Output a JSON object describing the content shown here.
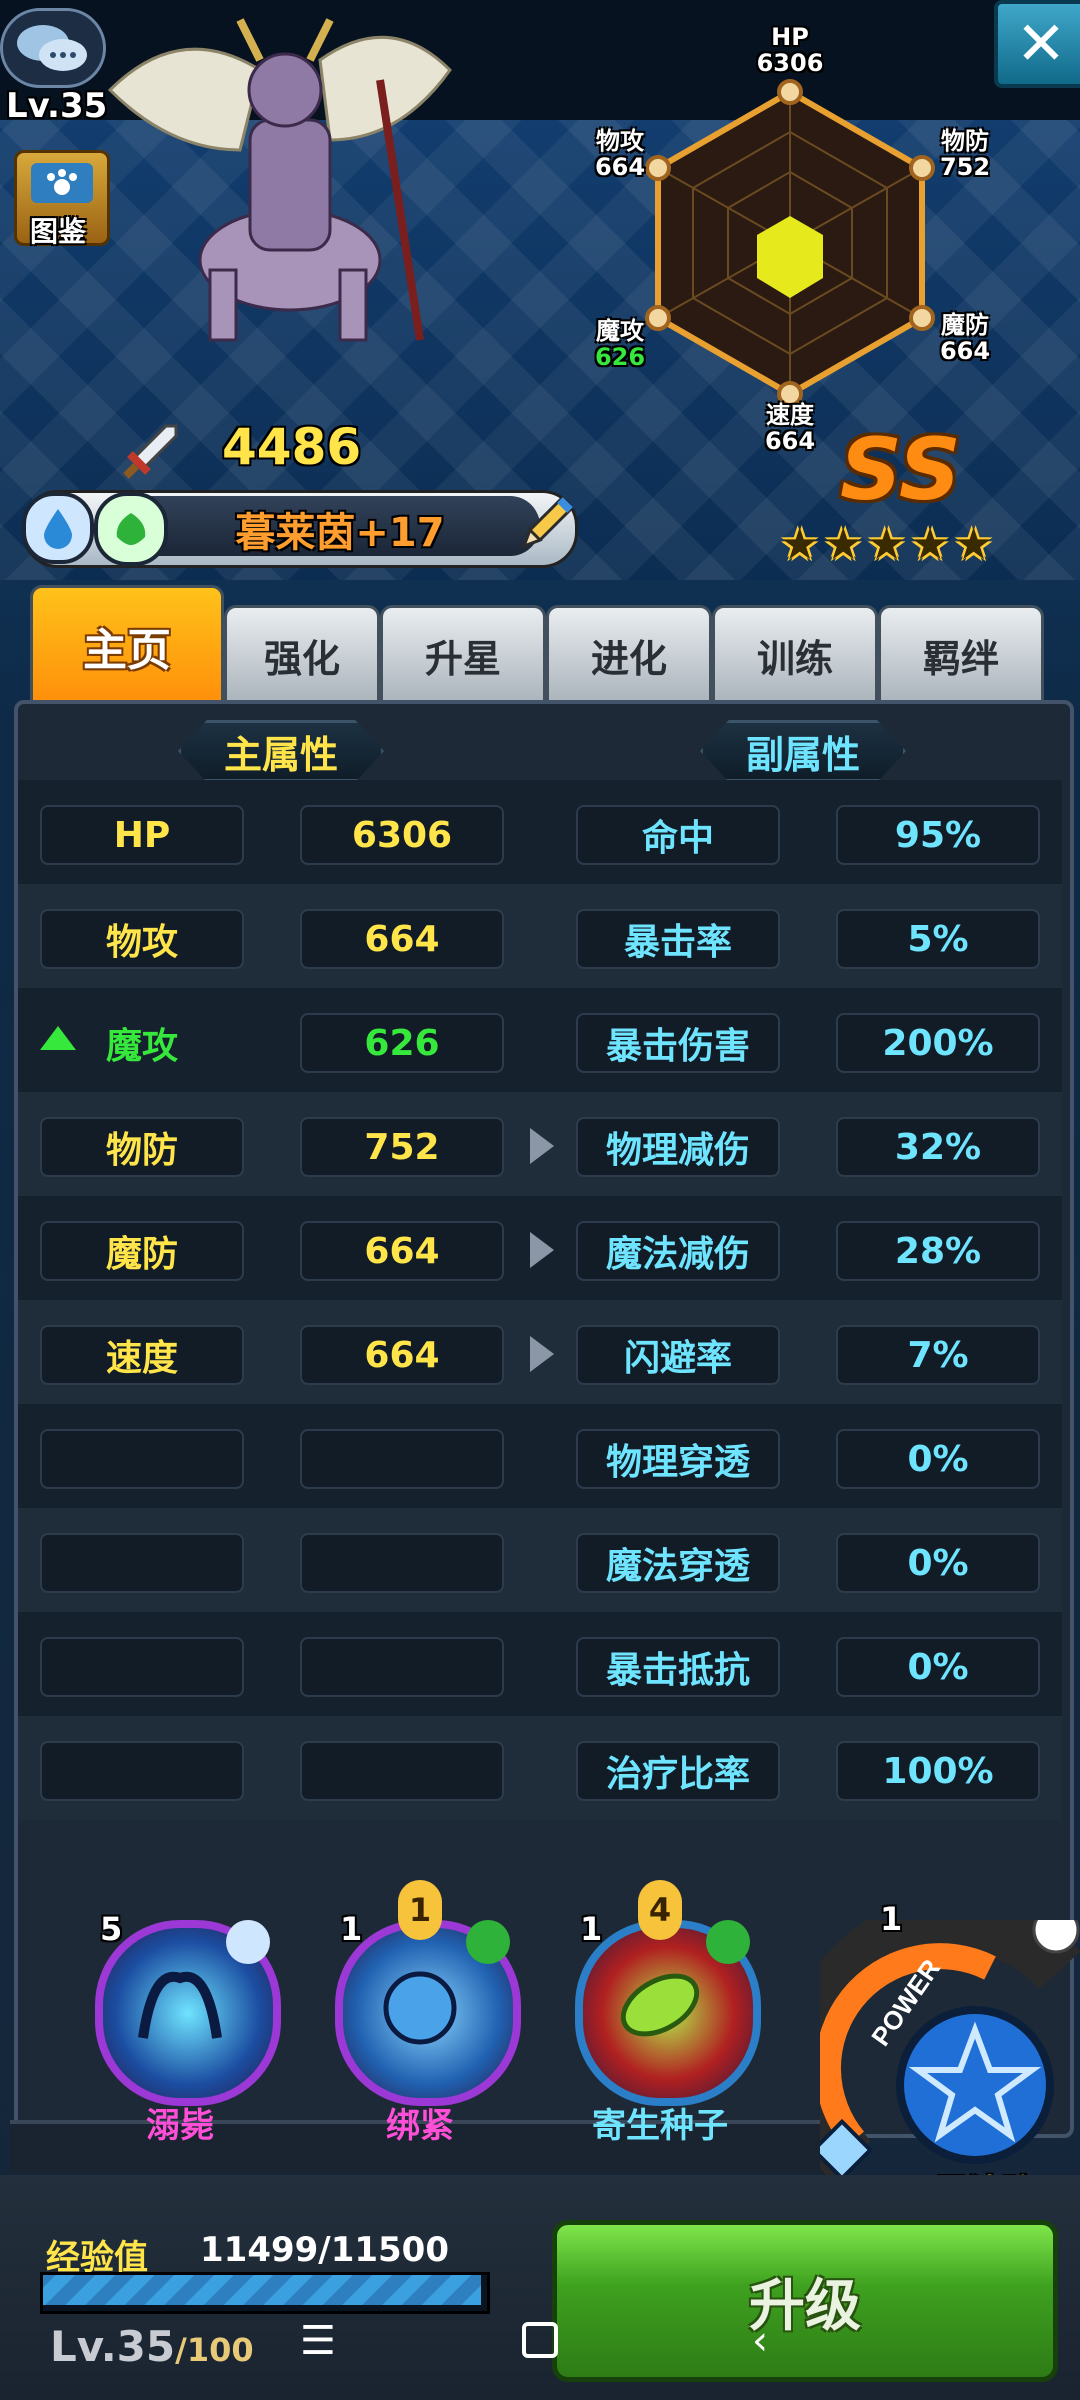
{
  "hero": {
    "level": "Lv.35",
    "power": "4486",
    "name": "暮莱茵+17",
    "rank": "SS",
    "stars": 5
  },
  "top_left": {
    "encyclopedia_label": "图鉴"
  },
  "radar": {
    "hp_label": "HP",
    "hp_value": "6306",
    "patk_label": "物攻",
    "patk_value": "664",
    "pdef_label": "物防",
    "pdef_value": "752",
    "matk_label": "魔攻",
    "matk_value": "626",
    "mdef_label": "魔防",
    "mdef_value": "664",
    "speed_label": "速度",
    "speed_value": "664"
  },
  "tabs": [
    {
      "label": "主页",
      "active": true
    },
    {
      "label": "强化"
    },
    {
      "label": "升星"
    },
    {
      "label": "进化"
    },
    {
      "label": "训练"
    },
    {
      "label": "羁绊"
    }
  ],
  "sections": {
    "main": "主属性",
    "sub": "副属性"
  },
  "stats": [
    {
      "main_name": "HP",
      "main_value": "6306",
      "sub_name": "命中",
      "sub_value": "95%"
    },
    {
      "main_name": "物攻",
      "main_value": "664",
      "sub_name": "暴击率",
      "sub_value": "5%"
    },
    {
      "main_name": "魔攻",
      "main_value": "626",
      "sub_name": "暴击伤害",
      "sub_value": "200%"
    },
    {
      "main_name": "物防",
      "main_value": "752",
      "sub_name": "物理减伤",
      "sub_value": "32%"
    },
    {
      "main_name": "魔防",
      "main_value": "664",
      "sub_name": "魔法减伤",
      "sub_value": "28%"
    },
    {
      "main_name": "速度",
      "main_value": "664",
      "sub_name": "闪避率",
      "sub_value": "7%"
    },
    {
      "main_name": "",
      "main_value": "",
      "sub_name": "物理穿透",
      "sub_value": "0%"
    },
    {
      "main_name": "",
      "main_value": "",
      "sub_name": "魔法穿透",
      "sub_value": "0%"
    },
    {
      "main_name": "",
      "main_value": "",
      "sub_name": "暴击抵抗",
      "sub_value": "0%"
    },
    {
      "main_name": "",
      "main_value": "",
      "sub_name": "治疗比率",
      "sub_value": "100%"
    }
  ],
  "skills": [
    {
      "name": "溺毙",
      "level": "5",
      "cost": ""
    },
    {
      "name": "绑紧",
      "level": "1",
      "cost": "1"
    },
    {
      "name": "寄生种子",
      "level": "1",
      "cost": "4"
    }
  ],
  "formation": {
    "power_label": "POWER",
    "level": "1",
    "name": "五星法阵"
  },
  "experience": {
    "label": "经验值",
    "value": "11499/11500",
    "progress": 0.9999,
    "level": "Lv.35",
    "max_level": "/100"
  },
  "upgrade_button": "升级",
  "colors": {
    "accent_orange": "#ff9d2e",
    "stat_yellow": "#ffe44a",
    "stat_green": "#37e83c",
    "stat_cyan": "#6fe4ff",
    "skill_pink": "#ff4fd8"
  }
}
